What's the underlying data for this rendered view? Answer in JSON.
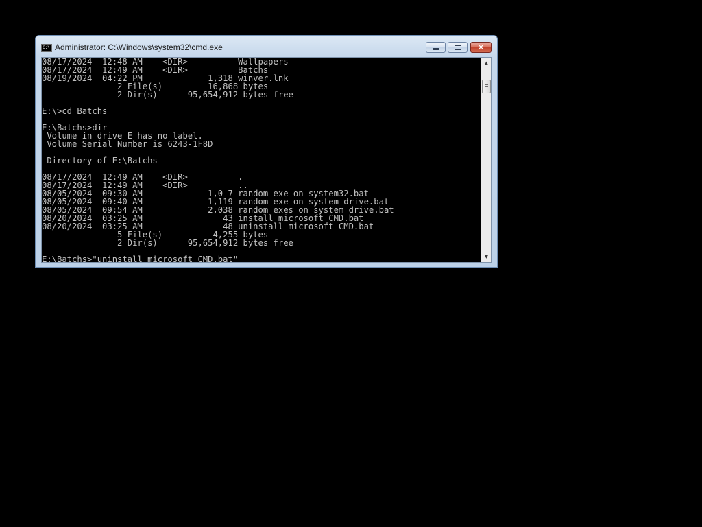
{
  "window": {
    "title": "Administrator: C:\\Windows\\system32\\cmd.exe",
    "icon_label": "C:\\",
    "buttons": {
      "minimize": "minimize-icon",
      "maximize": "restore-icon",
      "close": "close-icon",
      "close_glyph": "✕"
    }
  },
  "console": {
    "foreground": "#c0c0c0",
    "background": "#000000",
    "lines": [
      "08/17/2024  12:48 AM    <DIR>          Wallpapers",
      "08/17/2024  12:49 AM    <DIR>          Batchs",
      "08/19/2024  04:22 PM             1,318 winver.lnk",
      "               2 File(s)         16,868 bytes",
      "               2 Dir(s)      95,654,912 bytes free",
      "",
      "E:\\>cd Batchs",
      "",
      "E:\\Batchs>dir",
      " Volume in drive E has no label.",
      " Volume Serial Number is 6243-1F8D",
      "",
      " Directory of E:\\Batchs",
      "",
      "08/17/2024  12:49 AM    <DIR>          .",
      "08/17/2024  12:49 AM    <DIR>          ..",
      "08/05/2024  09:30 AM             1,0 7 random exe on system32.bat",
      "08/05/2024  09:40 AM             1,119 random exe on system drive.bat",
      "08/05/2024  09:54 AM             2,038 random exes on system drive.bat",
      "08/20/2024  03:25 AM                43 install microsoft CMD.bat",
      "08/20/2024  03:25 AM                48 uninstall microsoft CMD.bat",
      "               5 File(s)          4,255 bytes",
      "               2 Dir(s)      95,654,912 bytes free",
      "",
      "E:\\Batchs>\"uninstall microsoft CMD.bat\""
    ]
  },
  "scrollbar": {
    "up_arrow": "▲",
    "down_arrow": "▼"
  }
}
